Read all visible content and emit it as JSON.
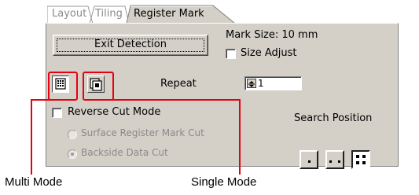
{
  "tabs": [
    {
      "label": "Layout",
      "active": false
    },
    {
      "label": "Tiling",
      "active": false
    },
    {
      "label": "Register Mark",
      "active": true
    }
  ],
  "exit_button": {
    "label": "Exit Detection"
  },
  "mark_size": {
    "text": "Mark Size: 10 mm"
  },
  "size_adjust": {
    "label": "Size Adjust",
    "checked": false
  },
  "mode_icons": [
    {
      "name": "multi-mode-icon",
      "selected": true
    },
    {
      "name": "single-mode-icon",
      "selected": false
    }
  ],
  "repeat": {
    "label": "Repeat",
    "value": "1"
  },
  "reverse_cut": {
    "label": "Reverse Cut Mode",
    "checked": false
  },
  "cut_options": [
    {
      "label": "Surface Register Mark Cut",
      "selected": false,
      "enabled": false
    },
    {
      "label": "Backside Data Cut",
      "selected": true,
      "enabled": false
    }
  ],
  "search_position": {
    "label": "Search Position",
    "options": [
      "position-1-icon",
      "position-2-icon",
      "position-4-icon"
    ]
  },
  "callouts": {
    "multi": "Multi Mode",
    "single": "Single Mode"
  },
  "colors": {
    "panel": "#d4d0c8",
    "callout": "#e60012"
  }
}
